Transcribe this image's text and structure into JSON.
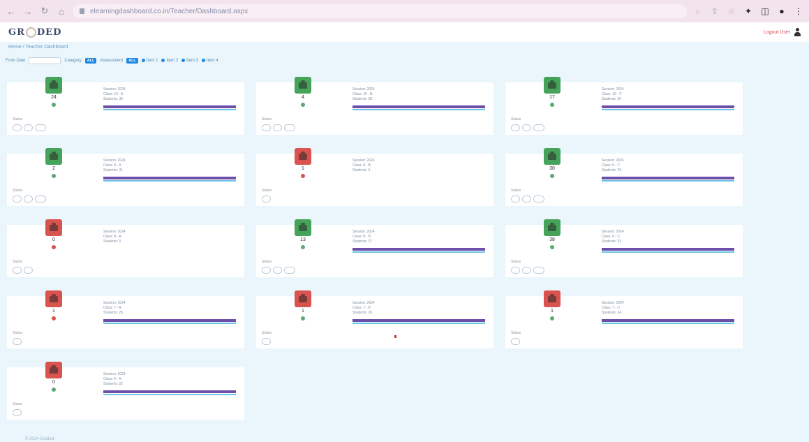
{
  "browser": {
    "url": "elearningdashboard.co.in/Teacher/Dashboard.aspx"
  },
  "app": {
    "logo_left": "GR",
    "logo_right": "DED",
    "user_link": "Logout User"
  },
  "breadcrumb": "Home / Teacher Dashboard",
  "filters": {
    "label": "From Date",
    "badge1_label": "Category",
    "badge1": "ALL",
    "badge2_label": "Assessment",
    "badge2": "ALL",
    "legend": [
      "Item 1",
      "Item 2",
      "Item 3",
      "Item 4"
    ]
  },
  "cards": [
    {
      "score": "24",
      "status": "green",
      "trend": "green",
      "line1": "Session: 2024",
      "line2": "Class: 10 - A",
      "line3": "Students: 32",
      "bars": true,
      "pills": 3
    },
    {
      "score": "4",
      "status": "green",
      "trend": "green",
      "line1": "Session: 2024",
      "line2": "Class: 10 - B",
      "line3": "Students: 28",
      "bars": true,
      "pills": 3
    },
    {
      "score": "17",
      "status": "green",
      "trend": "green",
      "line1": "Session: 2024",
      "line2": "Class: 10 - C",
      "line3": "Students: 30",
      "bars": true,
      "pills": 3
    },
    {
      "score": "2",
      "status": "green",
      "trend": "green",
      "line1": "Session: 2024",
      "line2": "Class: 9 - A",
      "line3": "Students: 31",
      "bars": true,
      "pills": 3
    },
    {
      "score": "1",
      "status": "red",
      "trend": "red",
      "line1": "Session: 2024",
      "line2": "Class: 9 - B",
      "line3": "Students: 0",
      "bars": false,
      "pills": 1
    },
    {
      "score": "30",
      "status": "green",
      "trend": "green",
      "line1": "Session: 2024",
      "line2": "Class: 9 - C",
      "line3": "Students: 29",
      "bars": true,
      "pills": 3
    },
    {
      "score": "0",
      "status": "red",
      "trend": "red",
      "line1": "Session: 2024",
      "line2": "Class: 8 - A",
      "line3": "Students: 0",
      "bars": false,
      "pills": 2
    },
    {
      "score": "13",
      "status": "green",
      "trend": "green",
      "line1": "Session: 2024",
      "line2": "Class: 8 - B",
      "line3": "Students: 27",
      "bars": true,
      "pills": 3
    },
    {
      "score": "38",
      "status": "green",
      "trend": "green",
      "line1": "Session: 2024",
      "line2": "Class: 8 - C",
      "line3": "Students: 33",
      "bars": true,
      "pills": 3
    },
    {
      "score": "1",
      "status": "red",
      "trend": "red",
      "line1": "Session: 2024",
      "line2": "Class: 7 - A",
      "line3": "Students: 25",
      "bars": true,
      "pills": 1
    },
    {
      "score": "1",
      "status": "red",
      "trend": "green",
      "line1": "Session: 2024",
      "line2": "Class: 7 - B",
      "line3": "Students: 26",
      "bars": true,
      "pills": 1
    },
    {
      "score": "1",
      "status": "red",
      "trend": "green",
      "line1": "Session: 2024",
      "line2": "Class: 7 - C",
      "line3": "Students: 24",
      "bars": true,
      "pills": 1
    },
    {
      "score": "0",
      "status": "red",
      "trend": "green",
      "line1": "Session: 2024",
      "line2": "Class: 6 - A",
      "line3": "Students: 22",
      "bars": true,
      "pills": 1
    }
  ],
  "status_label": "Status",
  "footer": "© 2024 Graded"
}
